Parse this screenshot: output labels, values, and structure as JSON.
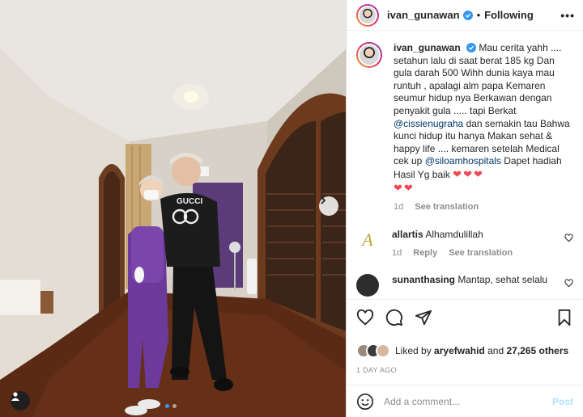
{
  "post": {
    "author": "ivan_gunawan",
    "separator": "•",
    "follow_status": "Following",
    "more_label": "•••"
  },
  "caption": {
    "username": "ivan_gunawan",
    "text_1": "Mau cerita yahh .... setahun lalu di saat berat 185 kg Dan gula darah 500 Wihh dunia kaya mau runtuh , apalagi alm papa Kemaren seumur hidup nya Berkawan dengan penyakit gula ..... tapi Berkat",
    "mention_1": "@cissienugraha",
    "text_2": "dan semakin tau Bahwa kunci hidup itu hanya Makan sehat & happy life .... kemaren setelah Medical cek up",
    "mention_2": "@siloamhospitals",
    "text_3": "Dapet hadiah Hasil Yg baik",
    "hearts_1": "❤❤❤",
    "hearts_2": "❤❤",
    "time": "1d",
    "see_translation": "See translation"
  },
  "comments": [
    {
      "username": "allartis",
      "text": "Alhamdulillah",
      "time": "1d",
      "reply": "Reply",
      "see_translation": "See translation",
      "avatar_letter": "A"
    },
    {
      "username": "sunanthasing",
      "text": "Mantap, sehat selalu"
    }
  ],
  "likes": {
    "prefix": "Liked by",
    "user": "aryefwahid",
    "middle": "and",
    "count": "27,265 others"
  },
  "date": "1 DAY AGO",
  "composer": {
    "placeholder": "Add a comment...",
    "post_label": "Post"
  },
  "carousel": {
    "slides": 2,
    "active": 1
  },
  "colors": {
    "link": "#00376b",
    "verified": "#3897f0",
    "heart": "#ed4956",
    "post_disabled": "#b2dffc",
    "muted": "#8e8e8e"
  },
  "icons": [
    "verified-icon",
    "more-icon",
    "chevron-right-icon",
    "user-tag-icon",
    "heart-icon",
    "comment-icon",
    "share-icon",
    "bookmark-icon",
    "emoji-icon"
  ]
}
